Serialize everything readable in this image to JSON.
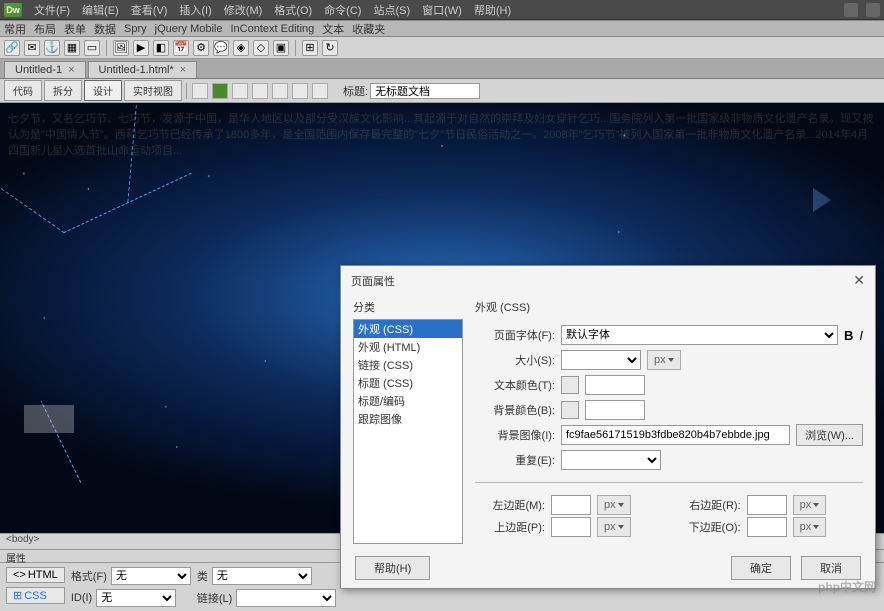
{
  "app": {
    "logo": "Dw"
  },
  "menu": {
    "items": [
      "文件(F)",
      "编辑(E)",
      "查看(V)",
      "插入(I)",
      "修改(M)",
      "格式(O)",
      "命令(C)",
      "站点(S)",
      "窗口(W)",
      "帮助(H)"
    ]
  },
  "toolbar_tabs": {
    "items": [
      "常用",
      "布局",
      "表单",
      "数据",
      "Spry",
      "jQuery Mobile",
      "InContext Editing",
      "文本",
      "收藏夹"
    ]
  },
  "doc_tabs": [
    {
      "label": "Untitled-1"
    },
    {
      "label": "Untitled-1.html*"
    }
  ],
  "view_bar": {
    "buttons": [
      "代码",
      "拆分",
      "设计",
      "实时视图"
    ],
    "active_index": 2,
    "title_label": "标题:",
    "title_value": "无标题文档"
  },
  "status": {
    "tag": "<body>",
    "panel_title": "属性"
  },
  "props": {
    "html_btn": "HTML",
    "css_btn": "CSS",
    "format_label": "格式(F)",
    "format_value": "无",
    "id_label": "ID(I)",
    "id_value": "无",
    "class_label": "类",
    "class_value": "无",
    "link_label": "链接(L)"
  },
  "dialog": {
    "title": "页面属性",
    "category_label": "分类",
    "categories": [
      "外观 (CSS)",
      "外观 (HTML)",
      "链接 (CSS)",
      "标题 (CSS)",
      "标题/编码",
      "跟踪图像"
    ],
    "selected_category_index": 0,
    "section_title": "外观 (CSS)",
    "font_label": "页面字体(F):",
    "font_value": "默认字体",
    "size_label": "大小(S):",
    "size_value": "",
    "size_unit": "px",
    "text_color_label": "文本颜色(T):",
    "text_color_value": "",
    "bg_color_label": "背景颜色(B):",
    "bg_color_value": "",
    "bg_image_label": "背景图像(I):",
    "bg_image_value": "fc9fae56171519b3fdbe820b4b7ebbde.jpg",
    "browse_btn": "浏览(W)...",
    "repeat_label": "重复(E):",
    "repeat_value": "",
    "margin_left_label": "左边距(M):",
    "margin_right_label": "右边距(R):",
    "margin_top_label": "上边距(P):",
    "margin_bottom_label": "下边距(O):",
    "margin_unit": "px",
    "help_btn": "帮助(H)",
    "ok_btn": "确定",
    "cancel_btn": "取消"
  },
  "watermark": "php中文网"
}
